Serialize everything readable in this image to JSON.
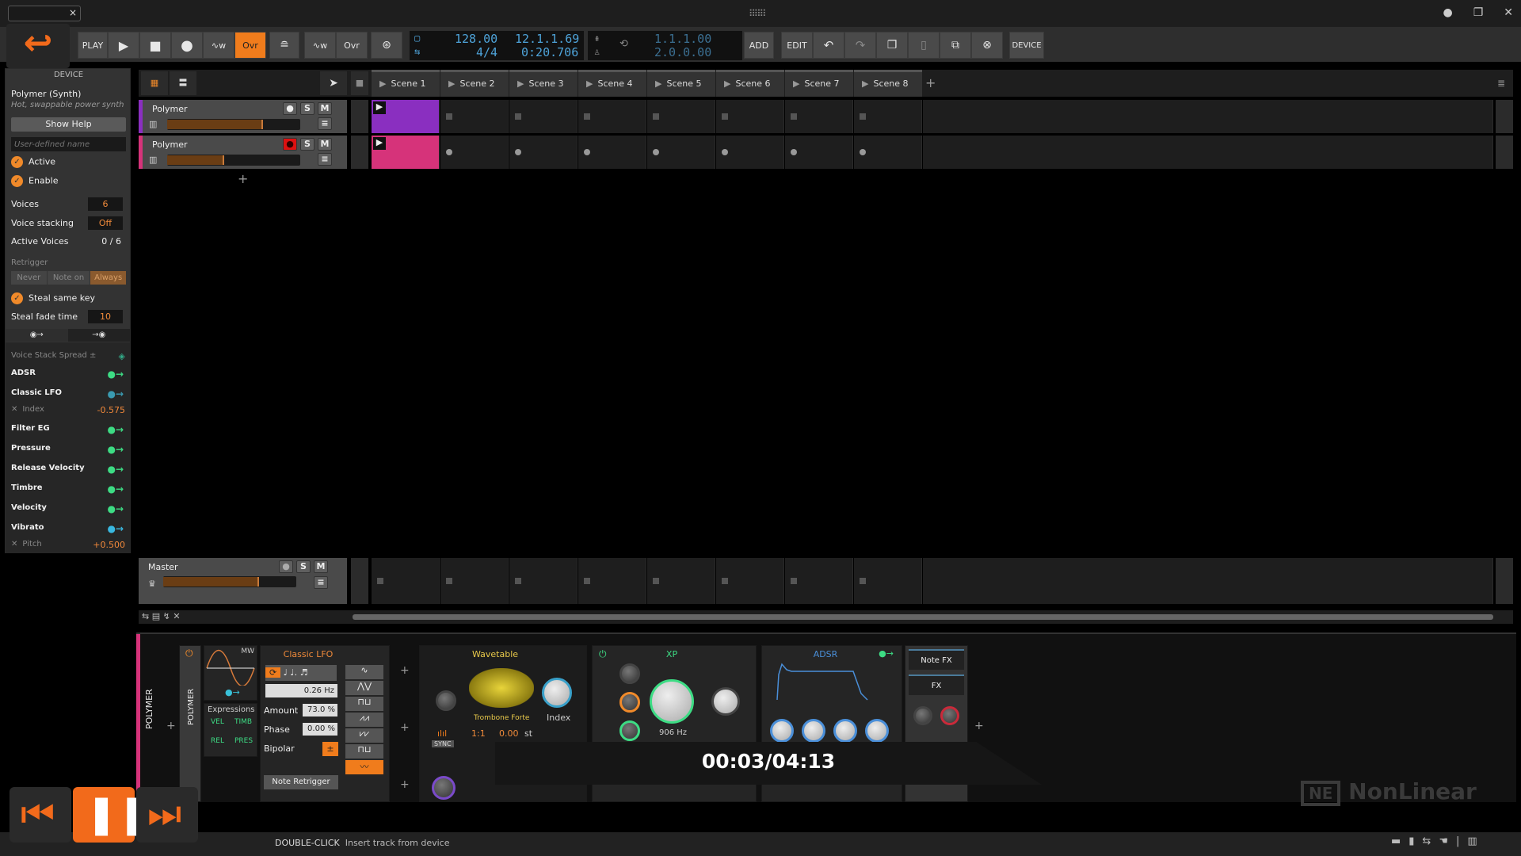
{
  "window": {
    "tab_close": "×",
    "controls": [
      "●",
      "❐",
      "✕"
    ]
  },
  "toolbar": {
    "play": "PLAY",
    "ovr": "Ovr",
    "ovr2": "Ovr",
    "tempo": "128.00",
    "signature": "4/4",
    "position": "12.1.1.69",
    "time": "0:20.706",
    "loop_start": "1.1.1.00",
    "loop_end": "2.0.0.00",
    "add": "ADD",
    "edit": "EDIT",
    "device": "DEVICE",
    "accent": "#f07c1c"
  },
  "inspector": {
    "header": "DEVICE",
    "device_name": "Polymer (Synth)",
    "device_desc": "Hot, swappable power synth",
    "show_help": "Show Help",
    "name_placeholder": "User-defined name",
    "active": "Active",
    "enable": "Enable",
    "voices_label": "Voices",
    "voices_value": "6",
    "stacking_label": "Voice stacking",
    "stacking_value": "Off",
    "active_voices_label": "Active Voices",
    "active_voices_value": "0 / 6",
    "retrigger_label": "Retrigger",
    "retrigger_options": [
      "Never",
      "Note on",
      "Always"
    ],
    "retrigger_selected": "Always",
    "steal_same_key": "Steal same key",
    "steal_fade_label": "Steal fade time",
    "steal_fade_value": "10",
    "spread": "Voice Stack Spread ±",
    "modulators": [
      {
        "name": "ADSR"
      },
      {
        "name": "Classic LFO",
        "sub": "Index",
        "subval": "-0.575"
      },
      {
        "name": "Filter EG"
      },
      {
        "name": "Pressure"
      },
      {
        "name": "Release Velocity"
      },
      {
        "name": "Timbre"
      },
      {
        "name": "Velocity"
      },
      {
        "name": "Vibrato",
        "sub": "Pitch",
        "subval": "+0.500"
      }
    ]
  },
  "scenes": [
    "Scene 1",
    "Scene 2",
    "Scene 3",
    "Scene 4",
    "Scene 5",
    "Scene 6",
    "Scene 7",
    "Scene 8"
  ],
  "tracks": [
    {
      "name": "Polymer",
      "color": "#8a2fc0",
      "level": 0.72,
      "armed": false
    },
    {
      "name": "Polymer",
      "color": "#d6337a",
      "level": 0.43,
      "armed": true
    }
  ],
  "master": {
    "name": "Master",
    "level": 0.72
  },
  "track_buttons": {
    "solo": "S",
    "mute": "M"
  },
  "device_chain": {
    "track_label": "POLYMER",
    "device_label": "POLYMER",
    "lfo_mini": "MW",
    "expressions": "Expressions",
    "expr": [
      "VEL",
      "TIMB",
      "REL",
      "PRES"
    ],
    "lfo": {
      "title": "Classic LFO",
      "rate": "0.26 Hz",
      "amount_label": "Amount",
      "amount": "73.0 %",
      "phase_label": "Phase",
      "phase": "0.00 %",
      "bipolar_label": "Bipolar",
      "bipolar": "±",
      "retrigger": "Note Retrigger"
    },
    "osc": {
      "title": "Wavetable",
      "wavetable": "Trombone Forte",
      "index": "Index",
      "ratio": "1:1",
      "semitones": "0.00",
      "st": "st",
      "sync": "SYNC"
    },
    "filter": {
      "title": "XP",
      "cutoff": "906 Hz"
    },
    "env": {
      "title": "ADSR"
    },
    "note_fx": "Note FX",
    "fx": "FX"
  },
  "status": {
    "action": "DOUBLE-CLICK",
    "hint": "Insert track from device"
  },
  "video": {
    "timer": "00:03/04:13",
    "watermark": "NonLinear"
  }
}
